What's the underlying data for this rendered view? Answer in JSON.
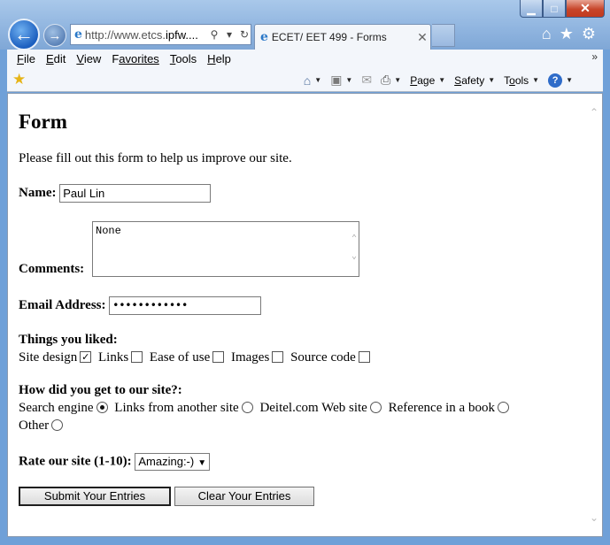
{
  "window": {
    "minimize": "▁",
    "maximize": "□",
    "close": "✕"
  },
  "address": {
    "url_prefix": "http://www.etcs.",
    "url_domain": "ipfw....",
    "search_icon": "⚲",
    "dropdown_icon": "▾",
    "refresh_icon": "↻"
  },
  "tab": {
    "title": "ECET/ EET 499 - Forms",
    "close": "✕"
  },
  "menu": {
    "items": [
      {
        "key": "F",
        "rest": "ile"
      },
      {
        "key": "E",
        "rest": "dit"
      },
      {
        "key": "V",
        "rest": "iew"
      },
      {
        "key": "F",
        "rest": "avorites",
        "underline_first": false
      },
      {
        "key": "T",
        "rest": "ools"
      },
      {
        "key": "H",
        "rest": "elp"
      }
    ],
    "chevron": "»"
  },
  "commandbar": {
    "page": "Page",
    "safety": "Safety",
    "tools": "Tools",
    "help": "?"
  },
  "form": {
    "heading": "Form",
    "intro": "Please fill out this form to help us improve our site.",
    "name_label": "Name:",
    "name_value": "Paul Lin",
    "comments_label": "Comments:",
    "comments_value": "None",
    "email_label": "Email Address:",
    "email_value": "••••••••••••",
    "liked_label": "Things you liked:",
    "liked_options": [
      {
        "label": "Site design",
        "checked": true
      },
      {
        "label": "Links",
        "checked": false
      },
      {
        "label": "Ease of use",
        "checked": false
      },
      {
        "label": "Images",
        "checked": false
      },
      {
        "label": "Source code",
        "checked": false
      }
    ],
    "how_label": "How did you get to our site?:",
    "how_options": [
      {
        "label": "Search engine",
        "selected": true
      },
      {
        "label": "Links from another site",
        "selected": false
      },
      {
        "label": "Deitel.com Web site",
        "selected": false
      },
      {
        "label": "Reference in a book",
        "selected": false
      },
      {
        "label": "Other",
        "selected": false
      }
    ],
    "rate_label": "Rate our site (1-10):",
    "rate_value": "Amazing:-)",
    "submit_label": "Submit Your Entries",
    "clear_label": "Clear Your Entries"
  },
  "icons": {
    "back": "back-arrow-icon",
    "forward": "forward-arrow-icon",
    "home": "home-icon",
    "favorites": "star-icon",
    "settings": "gear-icon",
    "feeds": "rss-icon",
    "mail": "mail-icon",
    "print": "printer-icon"
  }
}
